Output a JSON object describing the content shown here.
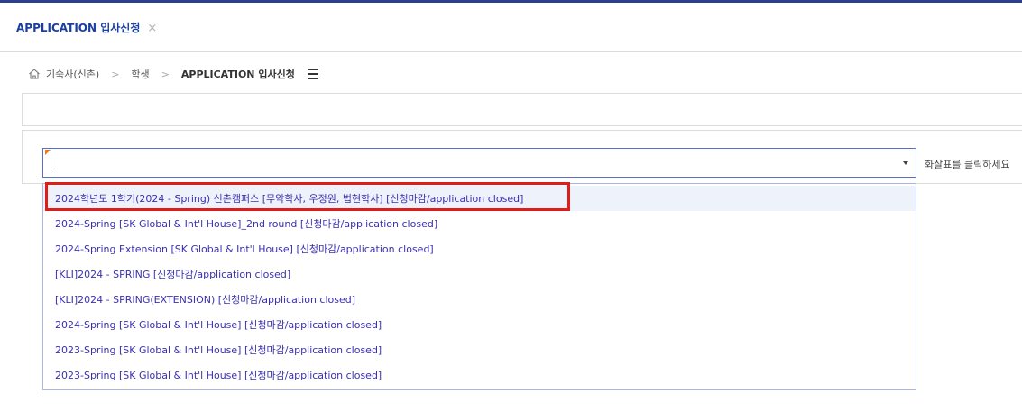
{
  "tab": {
    "label": "APPLICATION 입사신청",
    "close_symbol": "×"
  },
  "breadcrumb": {
    "items": [
      "기숙사(신촌)",
      "학생"
    ],
    "current": "APPLICATION 입사신청",
    "separator": ">"
  },
  "form": {
    "select_value": "",
    "hint": "화살표를 클릭하세요"
  },
  "dropdown": {
    "options": [
      "2024학년도 1학기(2024 - Spring) 신촌캠퍼스 [무악학사, 우정원, 법현학사] [신청마감/application closed]",
      "2024-Spring [SK Global & Int'l House]_2nd round [신청마감/application closed]",
      "2024-Spring Extension [SK Global & Int'l House] [신청마감/application closed]",
      "[KLI]2024 - SPRING [신청마감/application closed]",
      "[KLI]2024 - SPRING(EXTENSION) [신청마감/application closed]",
      "2024-Spring [SK Global & Int'l House]      [신청마감/application closed]",
      "2023-Spring [SK Global & Int'l House]      [신청마감/application closed]",
      "2023-Spring [SK Global & Int'l House]      [신청마감/application closed]"
    ],
    "highlighted_index": 0
  },
  "colors": {
    "accent": "#1a3fa3",
    "option_text": "#3a2fb0",
    "highlight_border": "#e01d1d",
    "combo_border": "#5a6fc7"
  },
  "icons": {
    "home": "home-icon",
    "menu": "hamburger-menu-icon",
    "dropdown": "dropdown-arrow-icon",
    "close": "close-icon"
  }
}
